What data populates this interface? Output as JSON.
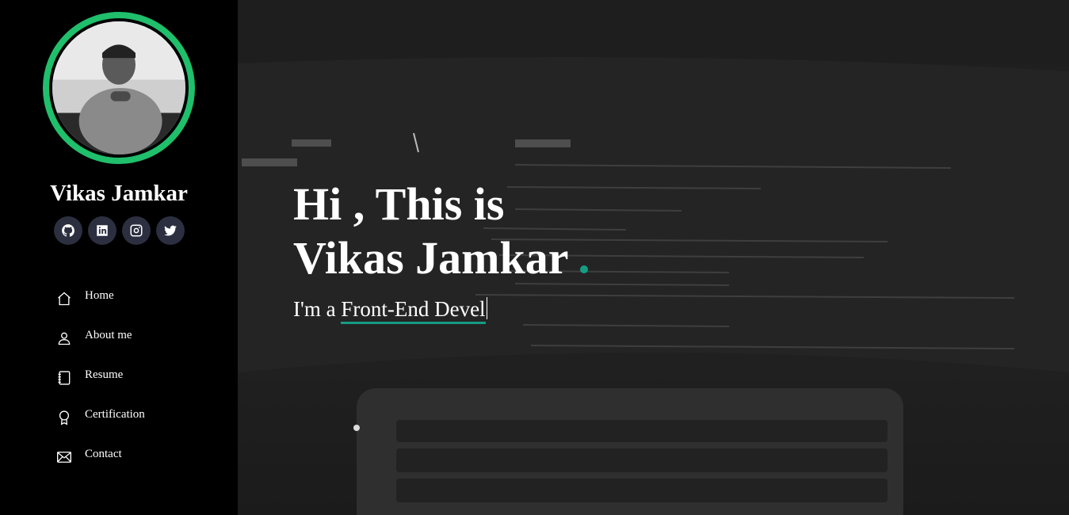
{
  "profile": {
    "name": "Vikas Jamkar",
    "avatar_icon": "profile-photo"
  },
  "socials": [
    {
      "icon": "github-icon"
    },
    {
      "icon": "linkedin-icon"
    },
    {
      "icon": "instagram-icon"
    },
    {
      "icon": "twitter-icon"
    }
  ],
  "nav": {
    "items": [
      {
        "label": "Home",
        "icon": "home-icon"
      },
      {
        "label": "About me",
        "icon": "person-icon"
      },
      {
        "label": "Resume",
        "icon": "notebook-icon"
      },
      {
        "label": "Certification",
        "icon": "award-icon"
      },
      {
        "label": "Contact",
        "icon": "envelope-icon"
      }
    ]
  },
  "hero": {
    "title_line1": "Hi , This is",
    "title_line2": "Vikas Jamkar",
    "sub_prefix": "I'm a",
    "sub_typed": "Front-End Devel"
  },
  "colors": {
    "accent_ring": "#1fbf6b",
    "typed_underline": "#149e82",
    "social_bg": "#2c2f3f"
  }
}
